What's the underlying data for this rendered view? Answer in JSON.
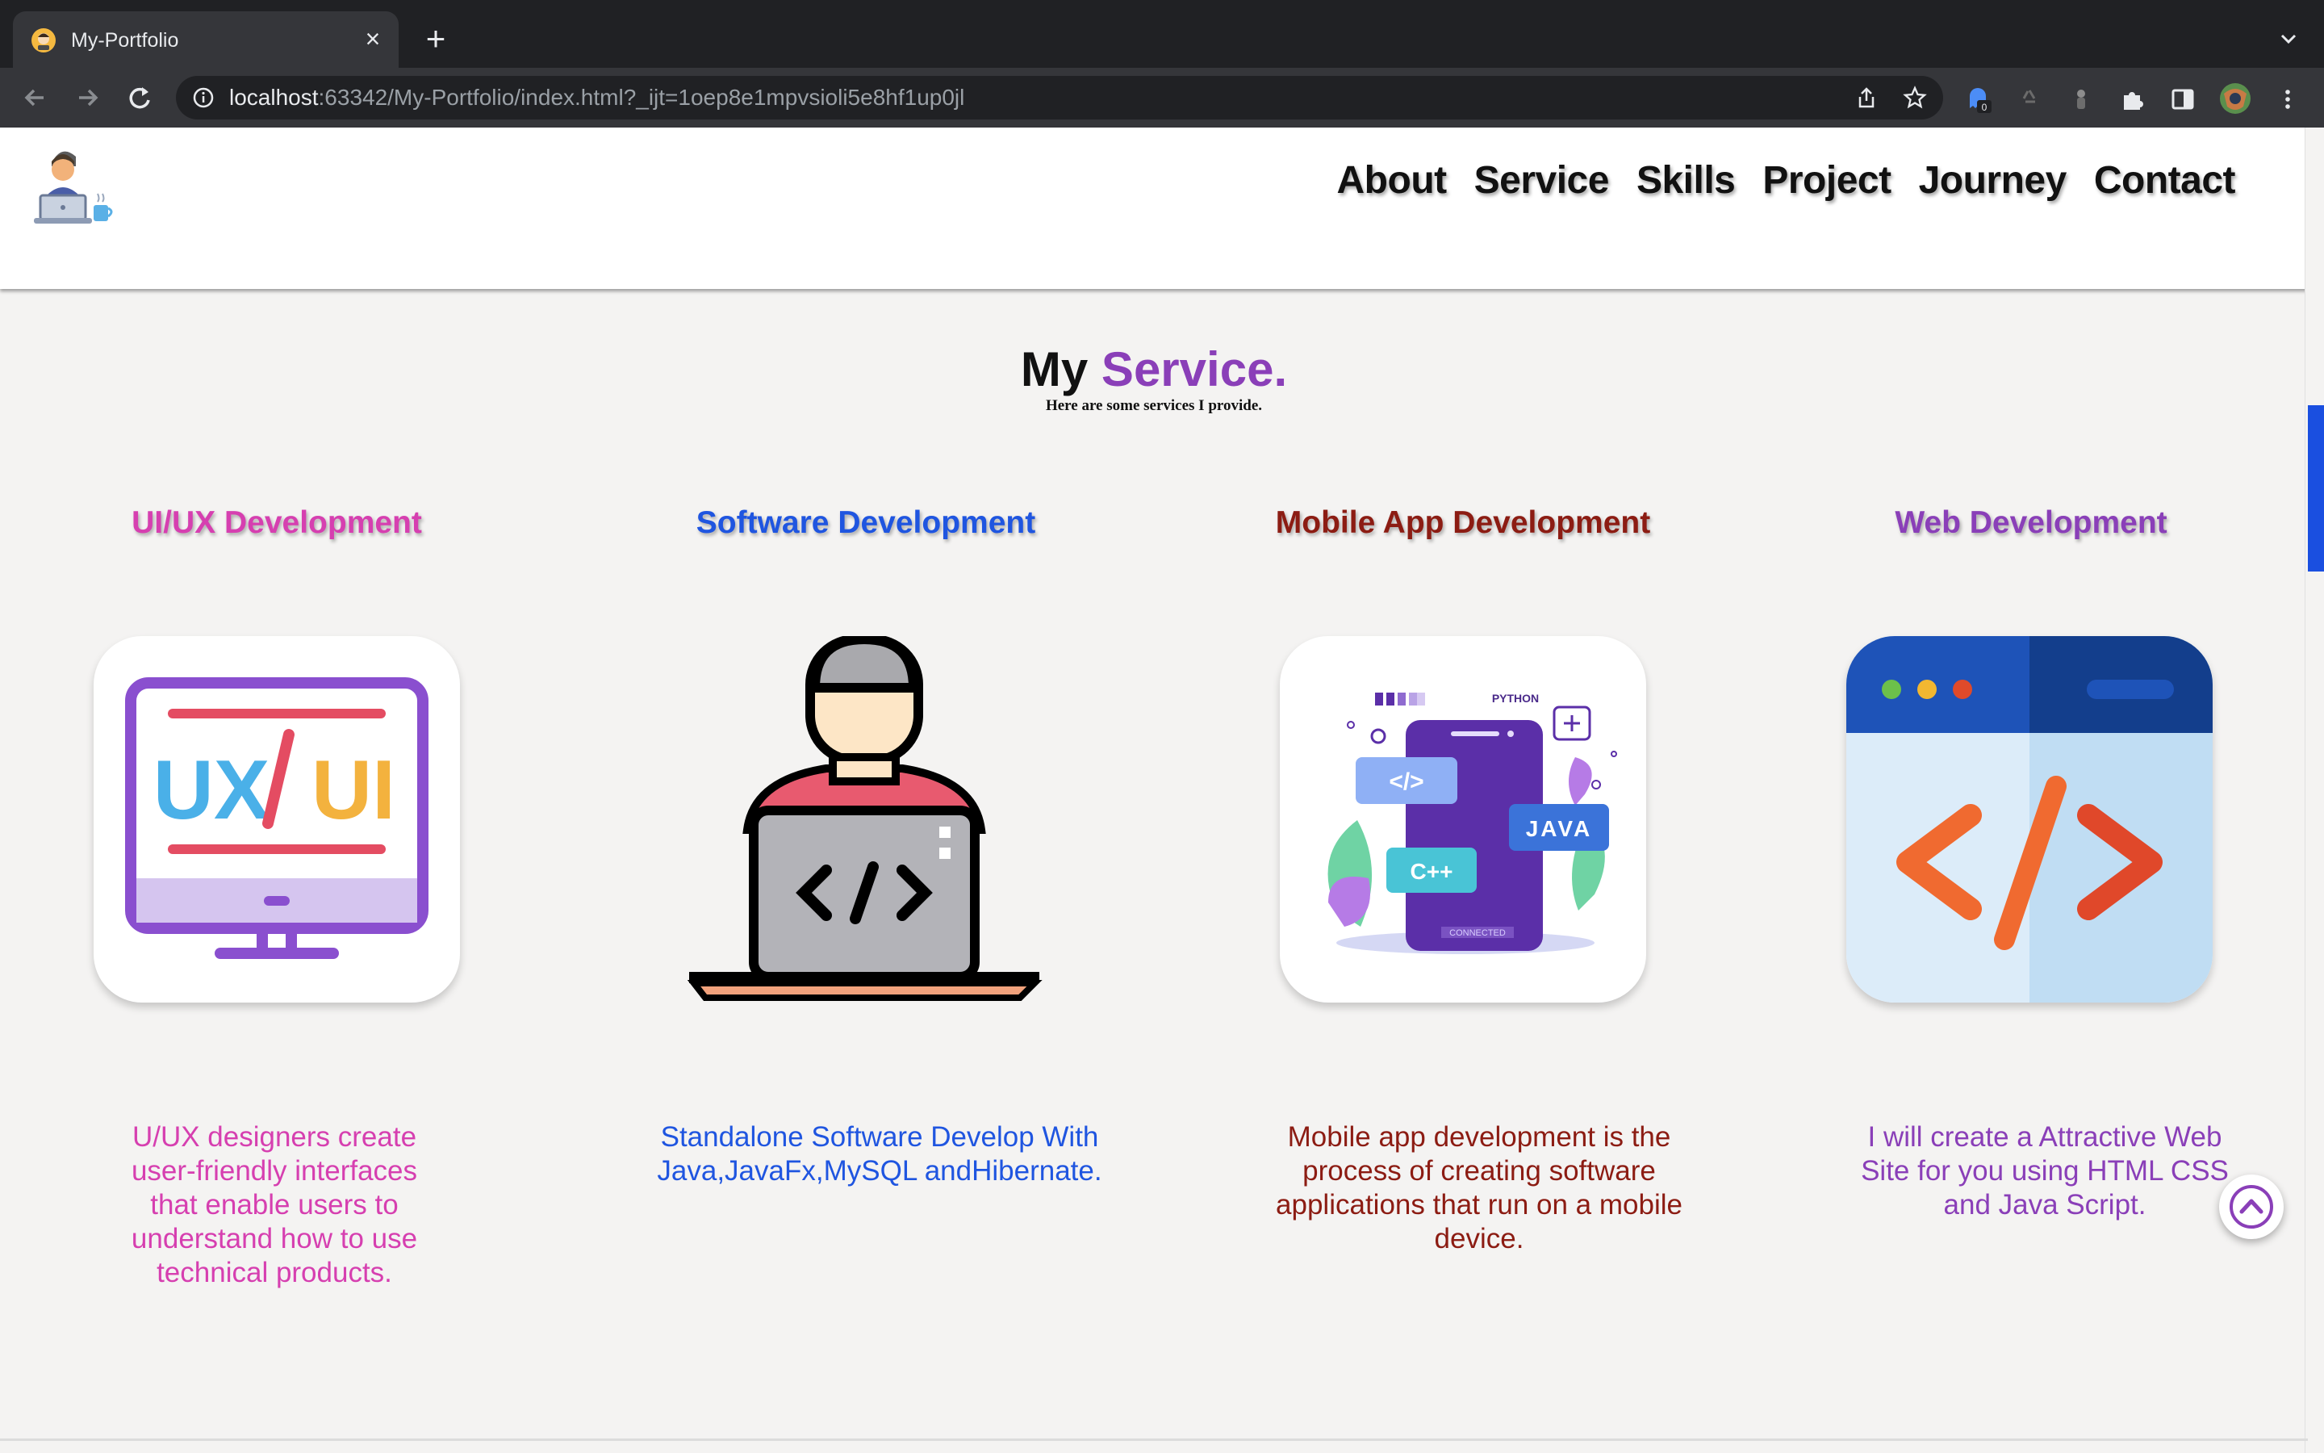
{
  "browser": {
    "tab_title": "My-Portfolio",
    "url_host": "localhost",
    "url_rest": ":63342/My-Portfolio/index.html?_ijt=1oep8e1mpvsioli5e8hf1up0jl",
    "extension_badge": "0"
  },
  "nav": {
    "items": [
      "About",
      "Service",
      "Skills",
      "Project",
      "Journey",
      "Contact"
    ]
  },
  "section": {
    "title_part1": "My",
    "title_part2": "Service.",
    "subtitle": "Here are some services I provide."
  },
  "services": [
    {
      "title": "UI/UX Development",
      "color": "#d63fb0",
      "icon": "ux-ui-monitor-icon",
      "icon_text_left": "UX",
      "icon_text_right": "UI",
      "description": "U/UX designers create user-friendly interfaces that enable users to understand how to use technical products."
    },
    {
      "title": "Software Development",
      "color": "#1f55e0",
      "icon": "developer-laptop-icon",
      "description": "Standalone Software Develop With Java,JavaFx,MySQL andHibernate."
    },
    {
      "title": "Mobile App Development",
      "color": "#8c1c13",
      "icon": "mobile-languages-icon",
      "icon_labels": [
        "PYTHON",
        "</>",
        "JAVA",
        "C++",
        "CONNECTED"
      ],
      "description": "Mobile app development is the process of creating software applications that run on a mobile device."
    },
    {
      "title": "Web Development",
      "color": "#8a3fb8",
      "icon": "code-window-icon",
      "description": "I will create a Attractive Web Site for you using HTML CSS and Java Script."
    }
  ],
  "scroll_top_icon": "chevron-up-circle-icon"
}
